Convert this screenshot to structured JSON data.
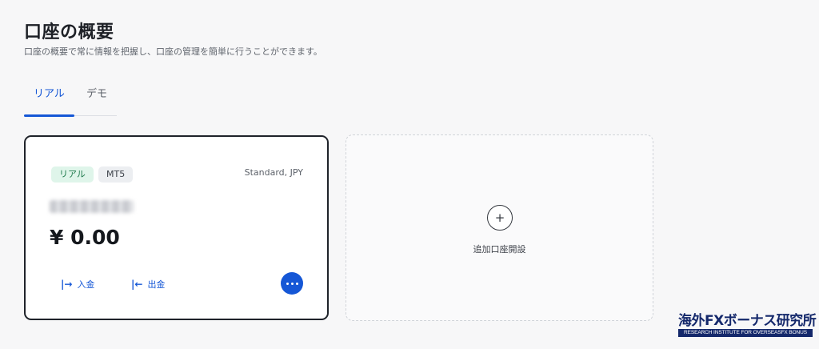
{
  "header": {
    "title": "口座の概要",
    "subtitle": "口座の概要で常に情報を把握し、口座の管理を簡単に行うことができます。"
  },
  "tabs": [
    {
      "label": "リアル",
      "active": true
    },
    {
      "label": "デモ",
      "active": false
    }
  ],
  "account_card": {
    "badges": [
      "リアル",
      "MT5"
    ],
    "account_type": "Standard, JPY",
    "account_number": "",
    "balance": "¥ 0.00",
    "actions": {
      "deposit": "入金",
      "withdraw": "出金"
    },
    "icons": {
      "deposit": "deposit-arrow-icon",
      "withdraw": "withdraw-arrow-icon",
      "more": "more-dots-icon"
    }
  },
  "add_account": {
    "label": "追加口座開設",
    "icon": "plus-icon"
  },
  "watermark": {
    "title": "海外FXボーナス研究所",
    "subtitle": "RESEARCH INSTITUTE FOR OVERSEASFX BONUS"
  },
  "colors": {
    "accent": "#1557d6",
    "badge_real_bg": "#dff5ea",
    "badge_mt5_bg": "#eceef1",
    "background": "#f7f7f8"
  }
}
